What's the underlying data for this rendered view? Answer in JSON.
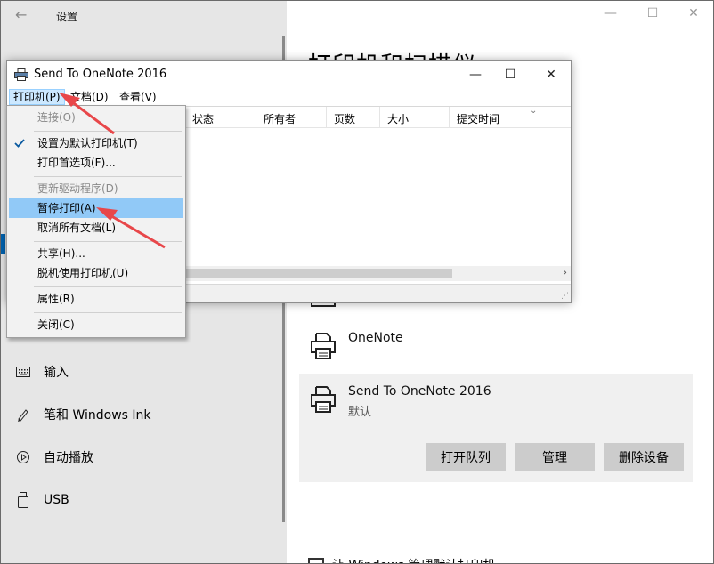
{
  "settings": {
    "title": "设置",
    "heading": "打印机和扫描仪",
    "nav": [
      {
        "label": "输入",
        "icon": "keyboard-icon"
      },
      {
        "label": "笔和 Windows Ink",
        "icon": "pen-icon"
      },
      {
        "label": "自动播放",
        "icon": "autoplay-icon"
      },
      {
        "label": "USB",
        "icon": "usb-icon"
      }
    ],
    "printers": [
      {
        "name": "OneNote",
        "status": ""
      },
      {
        "name": "Send To OneNote 2016",
        "status": "默认"
      }
    ],
    "actions": {
      "open_queue": "打开队列",
      "manage": "管理",
      "remove": "删除设备"
    },
    "bottom_option": "让 Windows 管理默认打印机"
  },
  "queue_window": {
    "title": "Send To OneNote 2016",
    "menus": [
      "打印机(P)",
      "文档(D)",
      "查看(V)"
    ],
    "columns": [
      "状态",
      "所有者",
      "页数",
      "大小",
      "提交时间"
    ]
  },
  "printer_menu": {
    "items": [
      {
        "label": "连接(O)",
        "disabled": true,
        "checked": false,
        "highlight": false
      },
      {
        "label": "设置为默认打印机(T)",
        "disabled": false,
        "checked": true,
        "highlight": false
      },
      {
        "label": "打印首选项(F)...",
        "disabled": false,
        "checked": false,
        "highlight": false
      },
      {
        "label": "更新驱动程序(D)",
        "disabled": true,
        "checked": false,
        "highlight": false
      },
      {
        "label": "暂停打印(A)",
        "disabled": false,
        "checked": false,
        "highlight": true
      },
      {
        "label": "取消所有文档(L)",
        "disabled": false,
        "checked": false,
        "highlight": false
      },
      {
        "label": "共享(H)...",
        "disabled": false,
        "checked": false,
        "highlight": false
      },
      {
        "label": "脱机使用打印机(U)",
        "disabled": false,
        "checked": false,
        "highlight": false
      },
      {
        "label": "属性(R)",
        "disabled": false,
        "checked": false,
        "highlight": false
      },
      {
        "label": "关闭(C)",
        "disabled": false,
        "checked": false,
        "highlight": false
      }
    ]
  },
  "colors": {
    "menu_highlight": "#91c9f7",
    "menu_active": "#cce8ff",
    "accent": "#0063b1",
    "annotation_arrow": "#e8474a"
  }
}
